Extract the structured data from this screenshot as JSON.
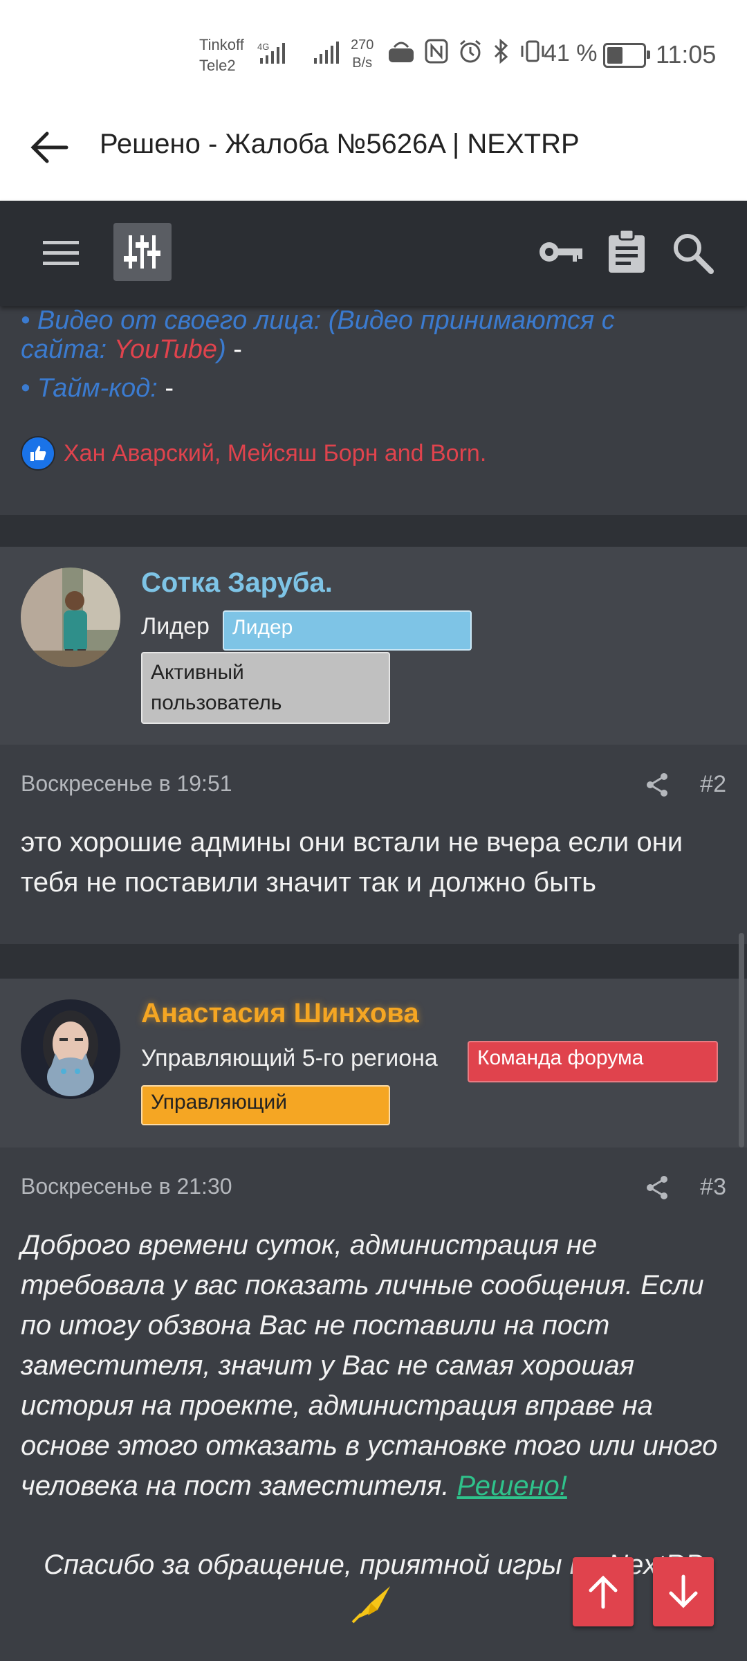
{
  "status_bar": {
    "carrier1": "Tinkoff",
    "carrier2": "Tele2",
    "net_type": "4G",
    "speed_value": "270",
    "speed_unit": "B/s",
    "battery": "41 %",
    "time": "11:05"
  },
  "app_bar": {
    "title": "Решено - Жалоба №5626A | NEXTRP"
  },
  "post1_tail": {
    "line1": "• Видео от своего лица: (Видео принимаются с",
    "line2_a": "сайта: ",
    "line2_youtube": "YouTube",
    "line2_b": ")",
    "line2_dash": " -",
    "line3": "• Тайм-код:",
    "line3_dash": " -",
    "reactions": "Хан Аварский, Мейсяш Борн and Born."
  },
  "post2": {
    "username": "Сотка Заруба.",
    "role": "Лидер",
    "badge1": "Лидер",
    "badge2_line1": "Активный",
    "badge2_line2": "пользователь",
    "date": "Воскресенье в 19:51",
    "number": "#2",
    "text": "это хорошие админы они встали не вчера если они тебя не поставили значит так и должно быть"
  },
  "post3": {
    "username": "Анастасия Шинхова",
    "role": "Управляющий 5-го региона",
    "badge1": "Команда форума",
    "badge2": "Управляющий",
    "date": "Воскресенье в 21:30",
    "number": "#3",
    "text": "Доброго времени суток, администрация не требовала у вас показать личные сообщения. Если по итогу обзвона Вас не поставили на пост заместителя, значит у Вас не самая хорошая история на проекте, администрация вправе на основе этого отказать в установке того или иного человека на пост заместителя. ",
    "solved": "Решено!",
    "thanks": "Спасибо за обращение, приятной игры на NextRP"
  },
  "colors": {
    "background": "#34373d",
    "accent_red": "#e0434d",
    "leader_name": "#7ec4e6",
    "manager_name": "#f5a623",
    "solved_green": "#2fc28b"
  }
}
